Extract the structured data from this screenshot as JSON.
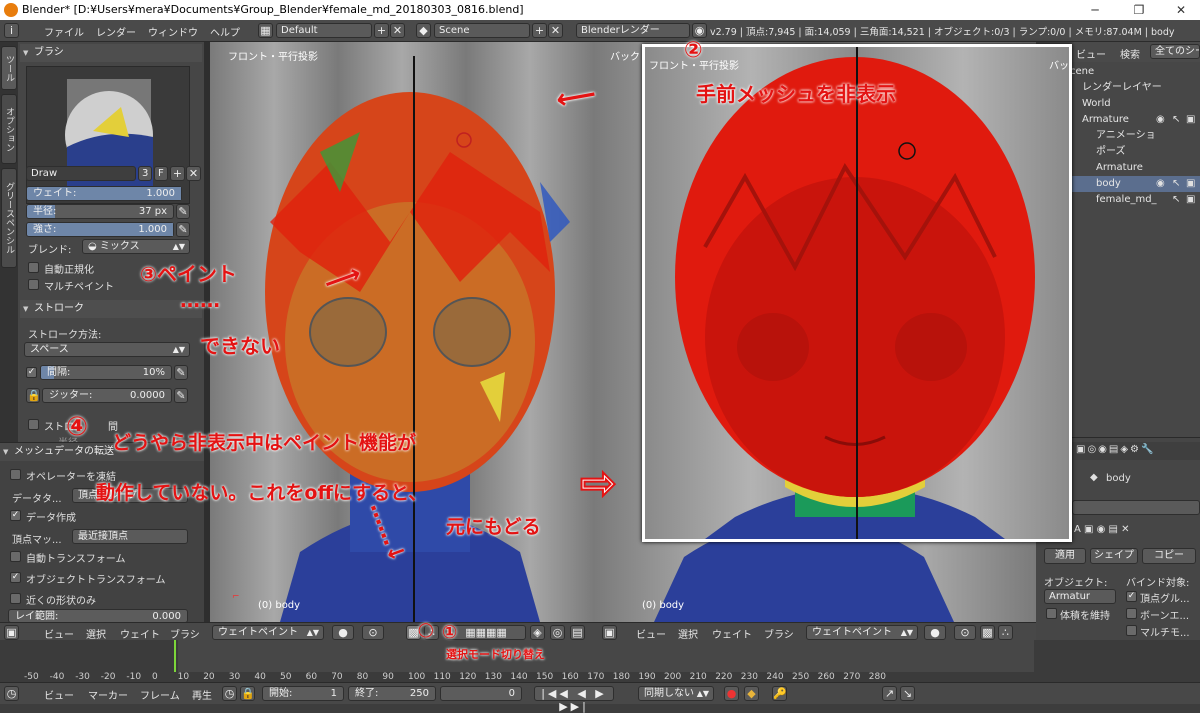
{
  "window": {
    "title": "Blender* [D:¥Users¥mera¥Documents¥Group_Blender¥female_md_20180303_0816.blend]",
    "minimize": "─",
    "maximize": "❐",
    "close": "✕"
  },
  "menubar": {
    "items": [
      "ファイル",
      "レンダー",
      "ウィンドウ",
      "ヘルプ"
    ],
    "layout": "Default",
    "scene": "Scene",
    "engine": "Blenderレンダー",
    "stats": "v2.79 | 頂点:7,945 | 面:14,059 | 三角面:14,521 | オブジェクト:0/3 | ランプ:0/0 | メモリ:87.04M | body",
    "plus": "+",
    "cross": "✕"
  },
  "tooltabs": [
    "ツール",
    "オプション",
    "グリースペンシル"
  ],
  "brush": {
    "header": "ブラシ",
    "name": "Draw",
    "users": "3",
    "fake": "F",
    "weight_label": "ウェイト:",
    "weight": "1.000",
    "weight_fill": 1.0,
    "radius_label": "半径:",
    "radius": "37 px",
    "radius_fill": 0.19,
    "strength_label": "強さ:",
    "strength": "1.000",
    "strength_fill": 1.0,
    "blend_label": "ブレンド:",
    "blend": "ミックス",
    "auto_normalize": "自動正規化",
    "multi_paint": "マルチペイント"
  },
  "stroke": {
    "header": "ストローク",
    "method_label": "ストローク方法:",
    "method": "スペース",
    "spacing_label": "間隔:",
    "spacing": "10%",
    "spacing_fill": 0.1,
    "jitter_label": "ジッター:",
    "jitter": "0.0000",
    "stroke_option": "ストロ",
    "stroke_option_suffix": "間",
    "hidden_label": "半径"
  },
  "operator": {
    "header": "メッシュデータの転送",
    "freeze": "オペレーターを凍結",
    "data_label": "データタ...",
    "data_value": "頂点グループ",
    "create_data": "データ作成",
    "vert_map_label": "頂点マッ...",
    "vert_map_value": "最近接頂点",
    "auto_transform": "自動トランスフォーム",
    "object_transform": "オブジェクトトランスフォーム",
    "only_shape": "近くの形状のみ",
    "ray_range_label": "レイ範囲:",
    "ray_range": "0.000"
  },
  "viewport_left": {
    "title": "フロント・平行投影",
    "object": "(0) body"
  },
  "viewport_right": {
    "title": "バック",
    "object": "(0) body"
  },
  "inset": {
    "title": "フロント・平行投影",
    "corner": "バック"
  },
  "header_left": {
    "menus": [
      "ビュー",
      "選択",
      "ウェイト",
      "ブラシ"
    ],
    "mode": "ウェイトペイント"
  },
  "header_right": {
    "menus": [
      "ビュー",
      "選択",
      "ウェイト",
      "ブラシ"
    ],
    "mode": "ウェイトペイント"
  },
  "outliner": {
    "view": "ビュー",
    "search": "検索",
    "filter": "全てのシー",
    "rows": [
      "cene",
      "レンダーレイヤー",
      "World",
      "Armature",
      "アニメーショ",
      "ポーズ",
      "Armature",
      "body",
      "female_md_"
    ]
  },
  "properties": {
    "object": "body",
    "apply": "適用",
    "shape": "シェイプ",
    "copy": "コピー",
    "object_label": "オブジェクト:",
    "object_value": "Armatur",
    "bind_label": "バインド対象:",
    "vertex_group": "頂点グル...",
    "keep_volume": "体積を維持",
    "bone_env": "ボーンエ...",
    "multi_modifier": "マルチモ..."
  },
  "timeline": {
    "ticks": [
      "-50",
      "-40",
      "-30",
      "-20",
      "-10",
      "0",
      "10",
      "20",
      "30",
      "40",
      "50",
      "60",
      "70",
      "80",
      "90",
      "100",
      "110",
      "120",
      "130",
      "140",
      "150",
      "160",
      "170",
      "180",
      "190",
      "200",
      "210",
      "220",
      "230",
      "240",
      "250",
      "260",
      "270",
      "280"
    ],
    "current_frame": 0
  },
  "playbar": {
    "menus": [
      "ビュー",
      "マーカー",
      "フレーム",
      "再生"
    ],
    "start_label": "開始:",
    "start": "1",
    "end_label": "終了:",
    "end": "250",
    "current": "0",
    "sync": "同期しない"
  },
  "annotations": {
    "n1": "①",
    "n1_text": "選択モード切り替え",
    "n2": "②",
    "n2_text": "手前メッシュを非表示",
    "n3": "③ペイント",
    "n3_dots": "……",
    "n3_cant": "できない",
    "n4": "④",
    "n4_line1": "どうやら非表示中はペイント機能が",
    "n4_line2": "動作していない。これをoffにすると、",
    "n4_line3": "元にもどる"
  },
  "colors": {
    "accent": "#e41313",
    "mesh_red": "#e01a0e",
    "mesh_blue": "#2b3f9a",
    "viewport_bg": "#8e8e8e"
  }
}
